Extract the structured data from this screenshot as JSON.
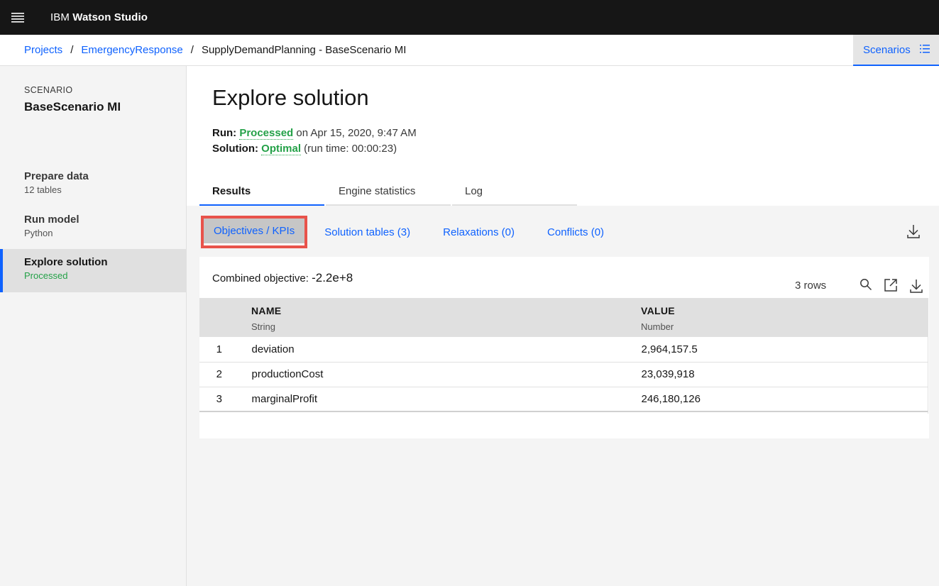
{
  "topbar": {
    "brand_prefix": "IBM",
    "brand_name": "Watson Studio"
  },
  "breadcrumb": {
    "items": [
      "Projects",
      "EmergencyResponse"
    ],
    "separator": "/",
    "current": "SupplyDemandPlanning - BaseScenario MI"
  },
  "scenarios_button": {
    "label": "Scenarios"
  },
  "sidebar": {
    "scenario_label": "SCENARIO",
    "scenario_name": "BaseScenario MI",
    "items": [
      {
        "name": "Prepare data",
        "sub": "12 tables"
      },
      {
        "name": "Run model",
        "sub": "Python"
      },
      {
        "name": "Explore solution",
        "sub": "Processed"
      }
    ]
  },
  "page": {
    "title": "Explore solution",
    "run_label": "Run:",
    "run_status": "Processed",
    "run_rest": "on Apr 15, 2020, 9:47 AM",
    "solution_label": "Solution:",
    "solution_status": "Optimal",
    "solution_rest": "(run time: 00:00:23)"
  },
  "tabs": [
    "Results",
    "Engine statistics",
    "Log"
  ],
  "subtabs": [
    "Objectives / KPIs",
    "Solution tables (3)",
    "Relaxations (0)",
    "Conflicts (0)"
  ],
  "results": {
    "combined_label": "Combined objective:",
    "combined_value": "-2.2e+8",
    "row_count": "3 rows",
    "columns": [
      {
        "name": "NAME",
        "type": "String"
      },
      {
        "name": "VALUE",
        "type": "Number"
      }
    ],
    "rows": [
      {
        "idx": "1",
        "name": "deviation",
        "value": "2,964,157.5"
      },
      {
        "idx": "2",
        "name": "productionCost",
        "value": "23,039,918"
      },
      {
        "idx": "3",
        "name": "marginalProfit",
        "value": "246,180,126"
      }
    ]
  },
  "colors": {
    "accent": "#0f62fe",
    "success": "#24a148",
    "highlight": "#e8534b",
    "topbar": "#161616"
  },
  "icons": [
    "menu-icon",
    "list-icon",
    "download-icon",
    "search-icon",
    "launch-icon"
  ]
}
